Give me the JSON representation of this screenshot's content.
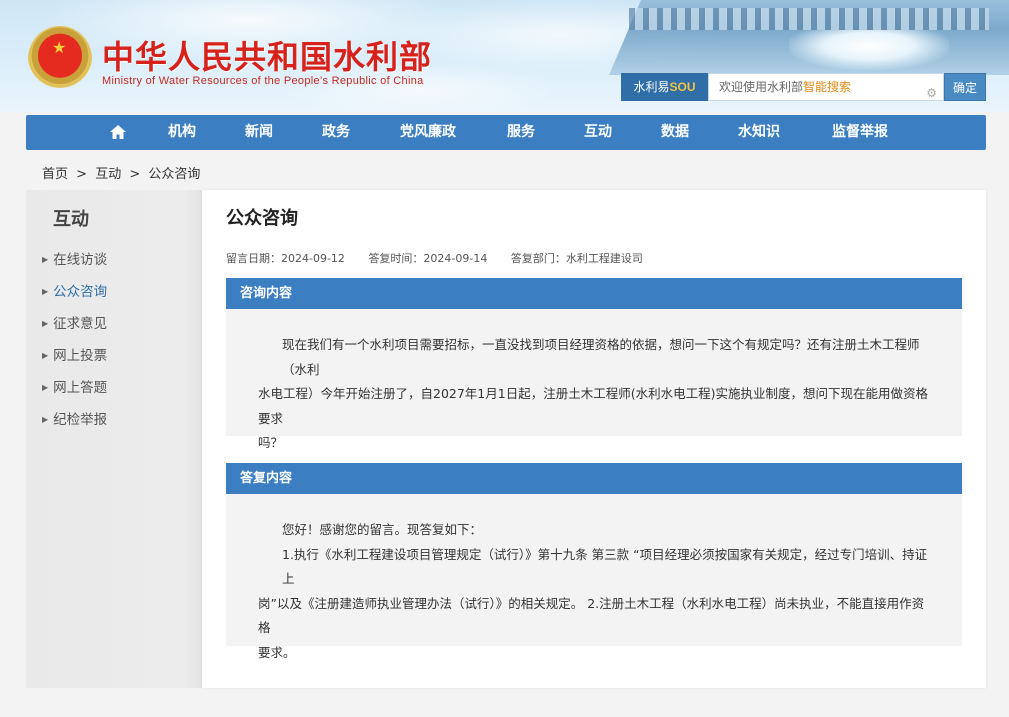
{
  "header": {
    "title": "中华人民共和国水利部",
    "subtitle": "Ministry of Water Resources of the People’s Republic of China",
    "search": {
      "brand_prefix": "水利易",
      "brand_suffix": "SOU",
      "placeholder_main": "欢迎使用水利部",
      "placeholder_highlight": "智能搜索",
      "button_label": "确定"
    }
  },
  "nav": {
    "home_icon": "home-icon",
    "items": [
      "机构",
      "新闻",
      "政务",
      "党风廉政",
      "服务",
      "互动",
      "数据",
      "水知识",
      "监督举报"
    ]
  },
  "breadcrumb": {
    "items": [
      "首页",
      "互动",
      "公众咨询"
    ],
    "separator": ">"
  },
  "sidebar": {
    "title": "互动",
    "items": [
      "在线访谈",
      "公众咨询",
      "征求意见",
      "网上投票",
      "网上答题",
      "纪检举报"
    ],
    "active": "公众咨询"
  },
  "main": {
    "title": "公众咨询",
    "meta": {
      "leave_date": "留言日期：2024-09-12",
      "reply_time": "答复时间：2024-09-14",
      "reply_dept": "答复部门：水利工程建设司"
    },
    "consult": {
      "heading": "咨询内容",
      "text_line1": "现在我们有一个水利项目需要招标，一直没找到项目经理资格的依据，想问一下这个有规定吗？还有注册土木工程师（水利",
      "text_line2": "水电工程）今年开始注册了，自2027年1月1日起，注册土木工程师(水利水电工程)实施执业制度，想问下现在能用做资格要求",
      "text_line3": "吗？"
    },
    "reply": {
      "heading": "答复内容",
      "line1": "您好！感谢您的留言。现答复如下：",
      "line2": "1.执行《水利工程建设项目管理规定（试行）》第十九条 第三款 “项目经理必须按国家有关规定，经过专门培训、持证上",
      "line3": "岗”以及《注册建造师执业管理办法（试行）》的相关规定。 2.注册土木工程（水利水电工程）尚未执业，不能直接用作资格",
      "line4": "要求。"
    }
  },
  "colors": {
    "primary_blue": "#3b7fc2",
    "title_red": "#d7211b",
    "sidebar_active": "#2f6ea7"
  }
}
